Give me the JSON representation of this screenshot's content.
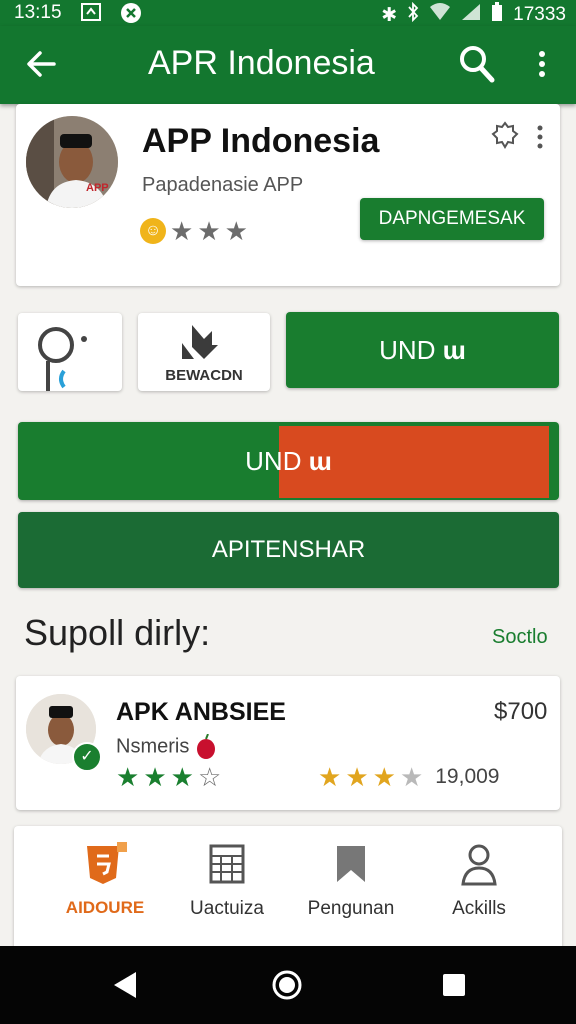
{
  "status_bar": {
    "time": "13:15",
    "battery_text": "17333"
  },
  "app_bar": {
    "title": "APR Indonesia",
    "back_icon": "arrow-back-icon",
    "search_icon": "search-icon",
    "more_icon": "more-vert-icon"
  },
  "app_card": {
    "name": "APP Indonesia",
    "developer": "Papadenasie APP",
    "avatar_badge": "APP",
    "action_label": "DAPNGEMESAK",
    "rating_filled_stars": 3
  },
  "tiles": {
    "tile2_label": "BEWACDN",
    "install_label": "UND",
    "install_glyph": "ɯ"
  },
  "progress": {
    "label": "UND",
    "glyph": "ɯ",
    "fraction_remaining": 0.5
  },
  "secondary_button": {
    "label": "APITENSHAR"
  },
  "section": {
    "title": "Supoll dirly:",
    "link": "Soctlo"
  },
  "list_item": {
    "name": "APK ANBSIEE",
    "subtitle": "Nsmeris",
    "price": "$700",
    "green_stars": 3,
    "outline_stars": 1,
    "gold_stars": 3,
    "grey_stars": 1,
    "count": "19,009"
  },
  "bottom_nav": {
    "items": [
      {
        "label": "AIDOURE",
        "icon": "html-shield-icon",
        "active": true
      },
      {
        "label": "Uactuiza",
        "icon": "calendar-grid-icon",
        "active": false
      },
      {
        "label": "Pengunan",
        "icon": "bookmark-icon",
        "active": false
      },
      {
        "label": "Ackills",
        "icon": "person-icon",
        "active": false
      }
    ]
  },
  "colors": {
    "primary_green": "#13772f",
    "button_green": "#197d2f",
    "dark_green": "#1b6b34",
    "progress_orange": "#d84a1f",
    "accent_orange": "#e06a1a"
  }
}
